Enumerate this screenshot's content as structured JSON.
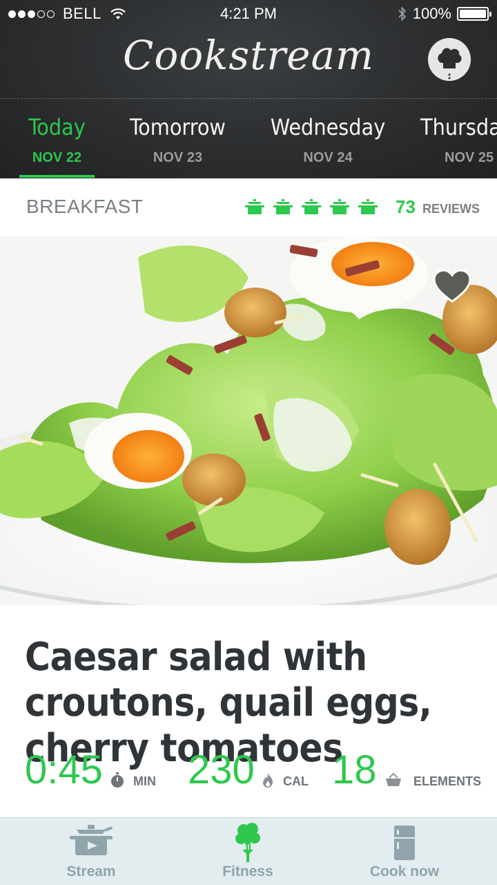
{
  "status_bar": {
    "carrier": "BELL",
    "time": "4:21 PM",
    "battery": "100%",
    "signal_strength": 3,
    "signal_max": 5
  },
  "header": {
    "app_title": "Cookstream",
    "avatar_icon": "chef-hat-icon"
  },
  "days": [
    {
      "name": "Today",
      "date": "NOV 22",
      "active": true
    },
    {
      "name": "Tomorrow",
      "date": "NOV 23",
      "active": false
    },
    {
      "name": "Wednesday",
      "date": "NOV 24",
      "active": false
    },
    {
      "name": "Thursday",
      "date": "NOV 25",
      "active": false
    }
  ],
  "recipe": {
    "category": "BREAKFAST",
    "rating": 5,
    "rating_max": 5,
    "rating_icon": "cooking-pot-icon",
    "review_count": "73",
    "review_label": "REVIEWS",
    "title": "Caesar salad with croutons, quail eggs, cherry tomatoes",
    "favorite_icon": "heart-icon",
    "stats": [
      {
        "value": "0:45",
        "label": "MIN",
        "icon": "timer-icon"
      },
      {
        "value": "230",
        "label": "CAL",
        "icon": "flame-icon"
      },
      {
        "value": "18",
        "label": "ELEMENTS",
        "icon": "basket-icon"
      }
    ]
  },
  "tab_bar": [
    {
      "label": "Stream",
      "icon": "pot-icon",
      "active": false
    },
    {
      "label": "Fitness",
      "icon": "broccoli-fork-icon",
      "active": true
    },
    {
      "label": "Cook now",
      "icon": "fridge-icon",
      "active": false
    }
  ],
  "colors": {
    "accent": "#2dc84d",
    "header_bg": "#2b2d2f",
    "title_text": "#2f3438",
    "muted_text": "#7a7f84",
    "tab_bar_bg": "#e3ecef"
  }
}
